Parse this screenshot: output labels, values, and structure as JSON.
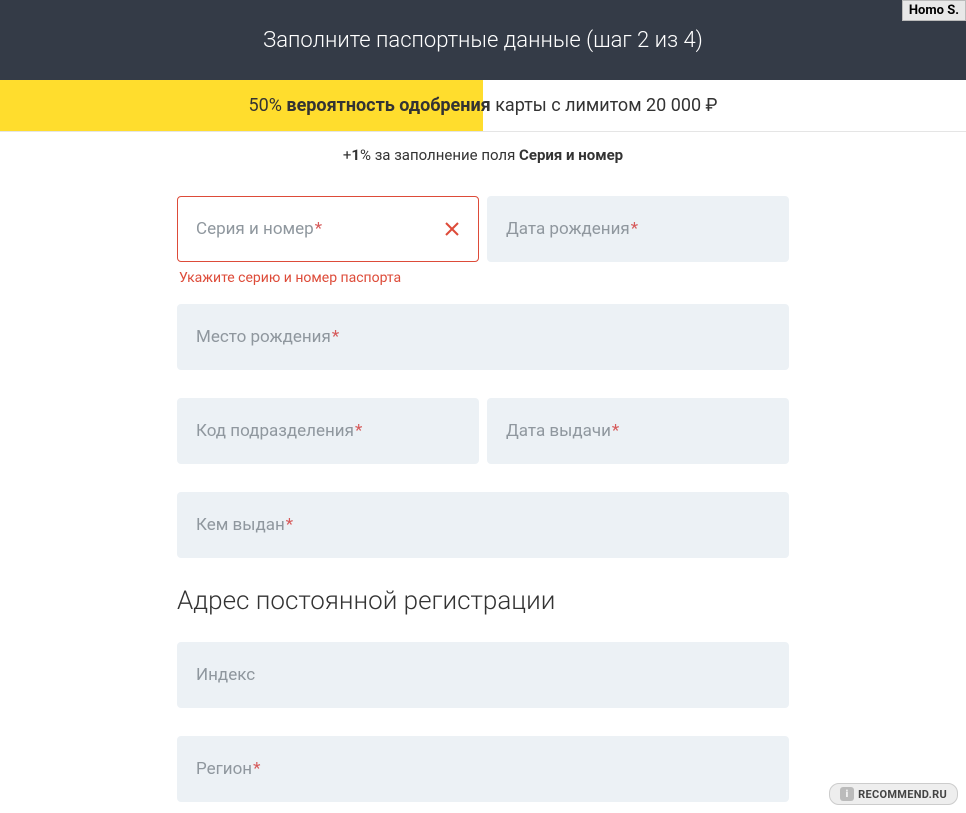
{
  "header": {
    "title": "Заполните паспортные данные (шаг 2 из 4)",
    "tag": "Homo S."
  },
  "progress": {
    "percent": "50%",
    "bold": "вероятность одобрения",
    "rest": " карты с лимитом 20 000 ₽"
  },
  "hint": {
    "plus": "+",
    "one": "1",
    "pct_text": "% за заполнение поля ",
    "bold": "Серия и номер"
  },
  "fields": {
    "series": {
      "label": "Серия и номер",
      "required": true,
      "error": "Укажите серию и номер паспорта"
    },
    "birth_date": {
      "label": "Дата рождения",
      "required": true
    },
    "birth_place": {
      "label": "Место рождения",
      "required": true
    },
    "dept_code": {
      "label": "Код подразделения",
      "required": true
    },
    "issue_date": {
      "label": "Дата выдачи",
      "required": true
    },
    "issued_by": {
      "label": "Кем выдан",
      "required": true
    },
    "section_title": "Адрес постоянной регистрации",
    "index": {
      "label": "Индекс",
      "required": false
    },
    "region": {
      "label": "Регион",
      "required": true
    }
  },
  "watermark": "RECOMMEND.RU"
}
